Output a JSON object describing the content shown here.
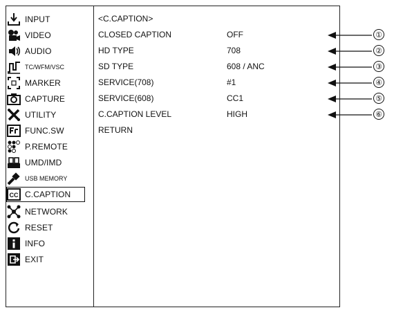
{
  "menu": {
    "items": [
      {
        "label": "INPUT",
        "icon": "input-icon"
      },
      {
        "label": "VIDEO",
        "icon": "video-icon"
      },
      {
        "label": "AUDIO",
        "icon": "audio-icon"
      },
      {
        "label": "TC/WFM/VSC",
        "icon": "waveform-icon"
      },
      {
        "label": "MARKER",
        "icon": "marker-icon"
      },
      {
        "label": "CAPTURE",
        "icon": "capture-icon"
      },
      {
        "label": "UTILITY",
        "icon": "utility-icon"
      },
      {
        "label": "FUNC.SW",
        "icon": "function-switch-icon"
      },
      {
        "label": "P.REMOTE",
        "icon": "remote-icon"
      },
      {
        "label": "UMD/IMD",
        "icon": "umd-icon"
      },
      {
        "label": "USB MEMORY",
        "icon": "usb-icon"
      },
      {
        "label": "C.CAPTION",
        "icon": "cc-icon",
        "selected": true
      },
      {
        "label": "NETWORK",
        "icon": "network-icon"
      },
      {
        "label": "RESET",
        "icon": "reset-icon"
      },
      {
        "label": "INFO",
        "icon": "info-icon"
      },
      {
        "label": "EXIT",
        "icon": "exit-icon"
      }
    ]
  },
  "submenu": {
    "title": "<C.CAPTION>",
    "rows": [
      {
        "param": "CLOSED CAPTION",
        "value": "OFF",
        "callout": "①"
      },
      {
        "param": "HD TYPE",
        "value": "708",
        "callout": "②"
      },
      {
        "param": "SD TYPE",
        "value": "608 / ANC",
        "callout": "③"
      },
      {
        "param": "SERVICE(708)",
        "value": "#1",
        "callout": "④"
      },
      {
        "param": "SERVICE(608)",
        "value": "CC1",
        "callout": "⑤"
      },
      {
        "param": "C.CAPTION LEVEL",
        "value": "HIGH",
        "callout": "⑥"
      },
      {
        "param": "RETURN",
        "value": ""
      }
    ]
  }
}
